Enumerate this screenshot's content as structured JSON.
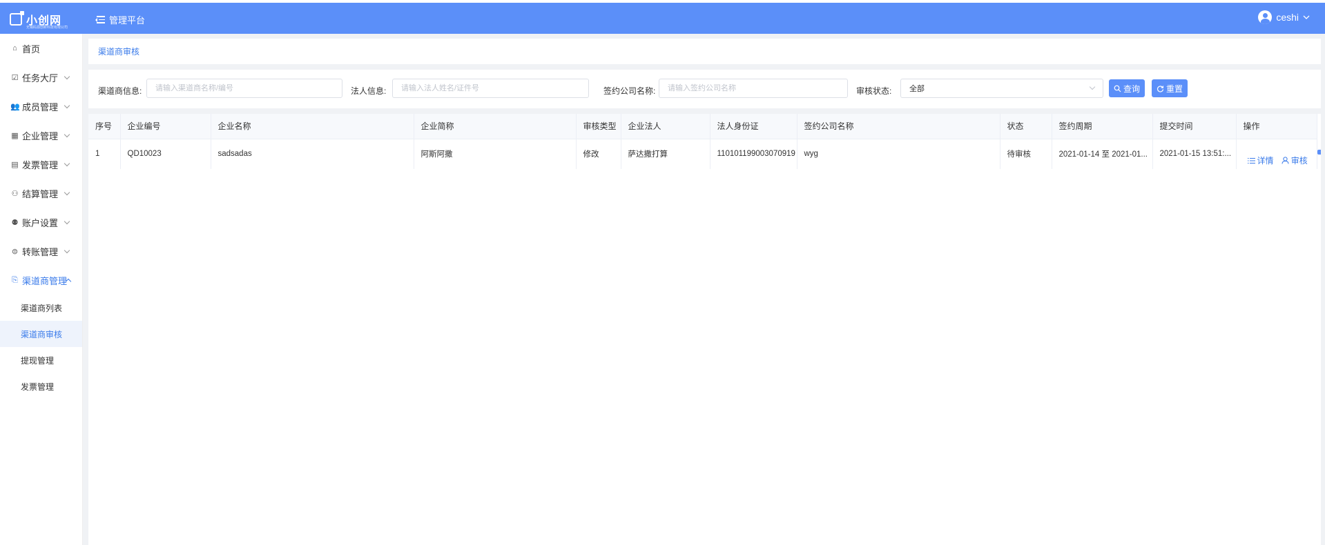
{
  "app": {
    "logo_text": "小创网",
    "logo_subtext": "无锡码源创新科技有限公司",
    "menu_title": "管理平台",
    "username": "ceshi"
  },
  "sidebar": {
    "items": [
      {
        "label": "首页",
        "icon": "home-icon",
        "glyph": "⌂",
        "expandable": false
      },
      {
        "label": "任务大厅",
        "icon": "task-icon",
        "glyph": "☑",
        "expandable": true
      },
      {
        "label": "成员管理",
        "icon": "members-icon",
        "glyph": "👥",
        "expandable": true
      },
      {
        "label": "企业管理",
        "icon": "building-icon",
        "glyph": "▦",
        "expandable": true
      },
      {
        "label": "发票管理",
        "icon": "invoice-icon",
        "glyph": "▤",
        "expandable": true
      },
      {
        "label": "结算管理",
        "icon": "settlement-icon",
        "glyph": "⚇",
        "expandable": true
      },
      {
        "label": "账户设置",
        "icon": "account-icon",
        "glyph": "⚉",
        "expandable": true
      },
      {
        "label": "转账管理",
        "icon": "transfer-icon",
        "glyph": "⊜",
        "expandable": true
      },
      {
        "label": "渠道商管理",
        "icon": "channel-icon",
        "glyph": "⎘",
        "expandable": true,
        "open": true
      }
    ],
    "sub_items": [
      {
        "label": "渠道商列表",
        "active": false
      },
      {
        "label": "渠道商审核",
        "active": true
      },
      {
        "label": "提现管理",
        "active": false
      },
      {
        "label": "发票管理",
        "active": false
      }
    ]
  },
  "breadcrumb": "渠道商审核",
  "filters": {
    "channel_label": "渠道商信息:",
    "channel_placeholder": "请输入渠道商名称/编号",
    "legal_label": "法人信息:",
    "legal_placeholder": "请输入法人姓名/证件号",
    "company_label": "签约公司名称:",
    "company_placeholder": "请输入签约公司名称",
    "status_label": "审核状态:",
    "status_value": "全部",
    "query_label": "查询",
    "reset_label": "重置"
  },
  "table": {
    "headers": [
      "序号",
      "企业编号",
      "企业名称",
      "企业简称",
      "审核类型",
      "企业法人",
      "法人身份证",
      "签约公司名称",
      "状态",
      "签约周期",
      "提交时间",
      "操作"
    ],
    "rows": [
      [
        "1",
        "QD10023",
        "sadsadas",
        "阿斯阿撒",
        "修改",
        "萨达撒打算",
        "110101199003070919",
        "wyg",
        "待审核",
        "2021-01-14 至 2021-01...",
        "2021-01-15 13:51:..."
      ]
    ],
    "actions": {
      "detail": "详情",
      "review": "审核"
    }
  }
}
